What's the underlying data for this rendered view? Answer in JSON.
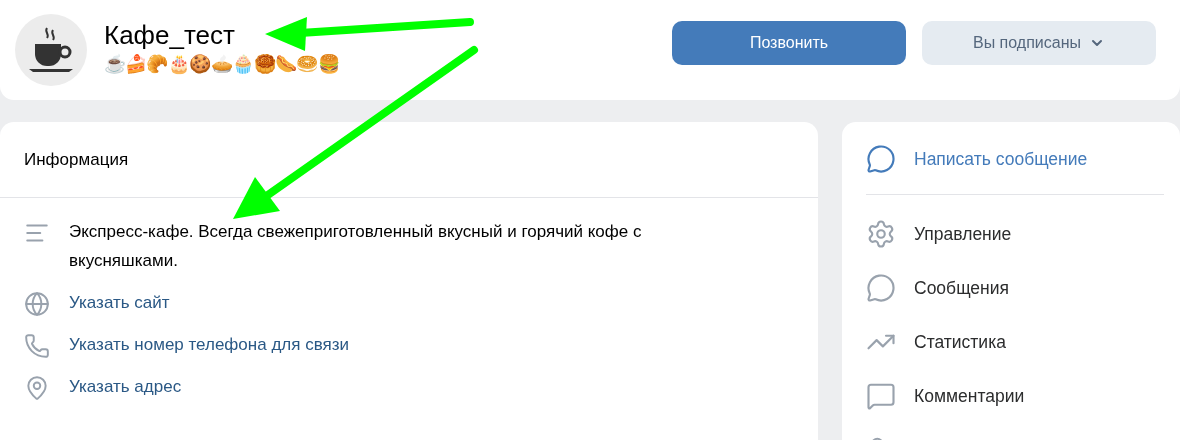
{
  "header": {
    "title": "Кафе_тест",
    "status": "☕🍰🥐🎂🍪🥧🧁🥮🌭🥯🍔",
    "buttons": [
      {
        "label": "Позвонить",
        "kind": "primary"
      },
      {
        "label": "Вы подписаны",
        "kind": "dropdown"
      }
    ]
  },
  "info": {
    "title": "Информация",
    "rows": [
      {
        "kind": "description",
        "text": "Экспресс-кафе. Всегда свежеприготовленный вкусный и горячий кофе с вкусняшками."
      },
      {
        "kind": "website",
        "text": "Указать сайт"
      },
      {
        "kind": "phone",
        "text": "Указать номер телефона для связи"
      },
      {
        "kind": "address",
        "text": "Указать адрес"
      }
    ]
  },
  "actions": [
    {
      "kind": "write",
      "label": "Написать сообщение"
    },
    {
      "kind": "manage",
      "label": "Управление"
    },
    {
      "kind": "messages",
      "label": "Сообщения"
    },
    {
      "kind": "stats",
      "label": "Статистика"
    },
    {
      "kind": "comments",
      "label": "Комментарии"
    }
  ]
}
